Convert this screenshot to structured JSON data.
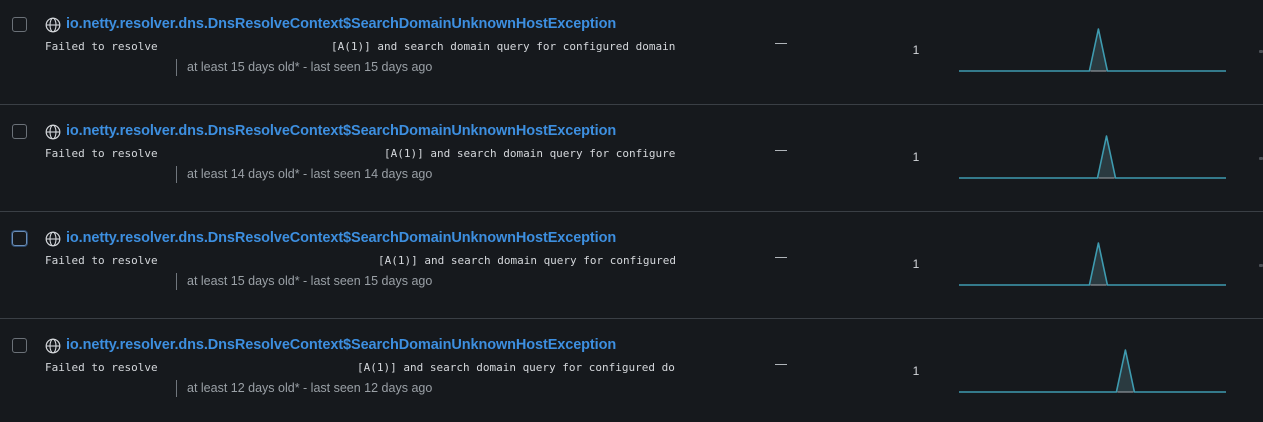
{
  "rows": [
    {
      "title": "io.netty.resolver.dns.DnsResolveContext$SearchDomainUnknownHostException",
      "msg_prefix": "Failed to resolve",
      "msg_suffix": "[A(1)] and search domain query for configured domain",
      "meta": "at least 15 days old* - last seen 15 days ago",
      "assignee": "—",
      "count": "1",
      "spike_position": 0.52
    },
    {
      "title": "io.netty.resolver.dns.DnsResolveContext$SearchDomainUnknownHostException",
      "msg_prefix": "Failed to resolve",
      "msg_suffix": "[A(1)] and search domain query for configure",
      "meta": "at least 14 days old* - last seen 14 days ago",
      "assignee": "—",
      "count": "1",
      "spike_position": 0.55
    },
    {
      "title": "io.netty.resolver.dns.DnsResolveContext$SearchDomainUnknownHostException",
      "msg_prefix": "Failed to resolve",
      "msg_suffix": "[A(1)] and search domain query for configured",
      "meta": "at least 15 days old* - last seen 15 days ago",
      "assignee": "—",
      "count": "1",
      "spike_position": 0.52
    },
    {
      "title": "io.netty.resolver.dns.DnsResolveContext$SearchDomainUnknownHostException",
      "msg_prefix": "Failed to resolve",
      "msg_suffix": "[A(1)] and search domain query for configured do",
      "meta": "at least 12 days old* - last seen 12 days ago",
      "assignee": "—",
      "count": "1",
      "spike_position": 0.62
    }
  ],
  "colors": {
    "title_link": "#3d8fe0",
    "sparkline": "#3e9bb0",
    "background": "#16191d",
    "divider": "#3a3f45"
  },
  "icons": {
    "row_icon": "globe-icon"
  }
}
